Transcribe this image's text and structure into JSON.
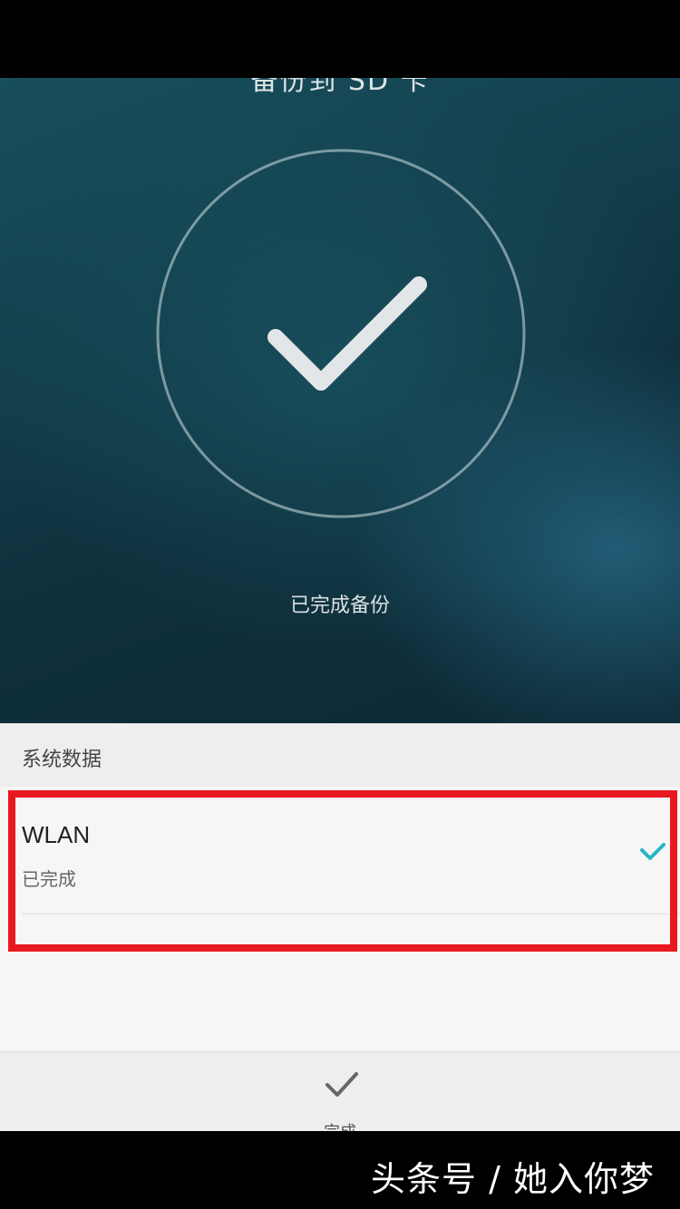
{
  "hero": {
    "title": "备份到 SD 卡",
    "status": "已完成备份",
    "success_icon": "checkmark-in-circle"
  },
  "section": {
    "header": "系统数据"
  },
  "list": {
    "items": [
      {
        "title": "WLAN",
        "subtitle": "已完成",
        "status_icon": "check-icon",
        "accent": "#2ab5c3"
      }
    ]
  },
  "bottom_bar": {
    "done_label": "完成",
    "done_icon": "check-icon"
  },
  "footer": {
    "watermark": "头条号 / 她入你梦"
  },
  "colors": {
    "highlight": "#e8191e",
    "accent": "#2ab5c3"
  }
}
